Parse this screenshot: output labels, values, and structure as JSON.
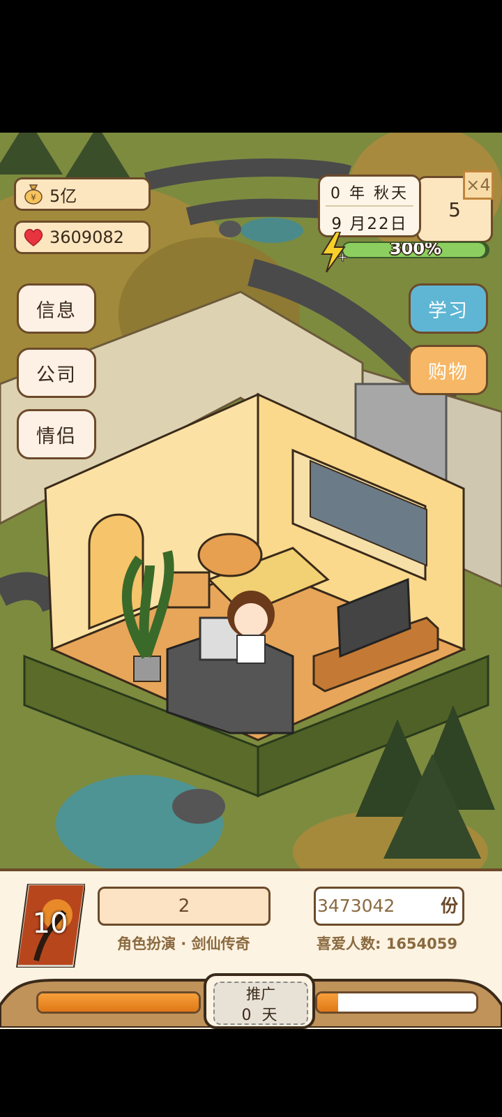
{
  "stats": {
    "money": "5亿",
    "hearts": "3609082"
  },
  "date": {
    "year_season": "0 年 秋天",
    "month_day": "9 月22日"
  },
  "speed": {
    "value": "5",
    "multiplier": "×4"
  },
  "energy": {
    "label": "300%",
    "fill_fraction": 0.98
  },
  "left_menu": [
    "信息",
    "公司",
    "情侣"
  ],
  "right_menu": {
    "study": "学习",
    "shop": "购物"
  },
  "colors": {
    "study_button": "#5fb6d4",
    "shop_button": "#f6b866",
    "progress_fill": "#f0901e",
    "energy_fill": "#8ccf60"
  },
  "work": {
    "book_number": "10",
    "count": "2",
    "title": "角色扮演 · 剑仙传奇",
    "copies": "3473042",
    "copies_unit": "份",
    "fans": "喜爱人数: 1654059"
  },
  "promotion": {
    "title": "推广",
    "days": "0 天"
  },
  "progress": {
    "left_fraction": 1.0,
    "right_fraction": 0.13
  }
}
